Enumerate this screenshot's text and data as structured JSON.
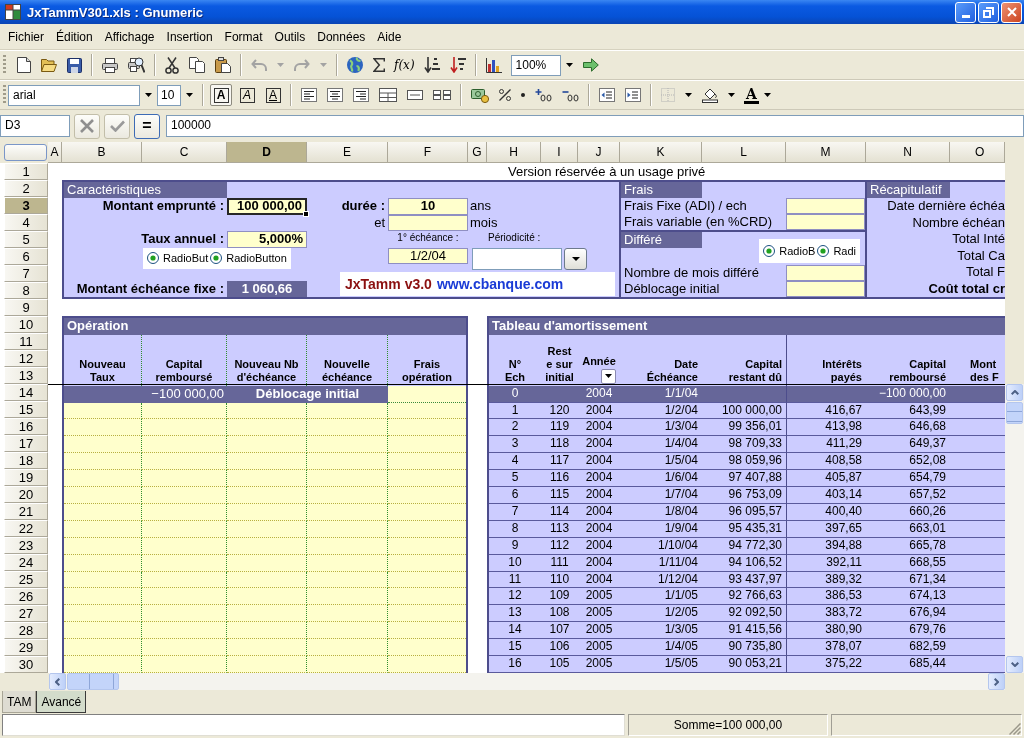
{
  "window": {
    "title": "JxTammV301.xls : Gnumeric"
  },
  "menu": [
    "Fichier",
    "Édition",
    "Affichage",
    "Insertion",
    "Format",
    "Outils",
    "Données",
    "Aide"
  ],
  "toolbar": {
    "undo_disabled": true,
    "redo_disabled": true,
    "function_label": "f(x)",
    "zoom": "100%"
  },
  "format_bar": {
    "font": "arial",
    "size": "10",
    "styles": [
      {
        "kind": "bold",
        "glyph": "A",
        "on": true
      },
      {
        "kind": "italic",
        "glyph": "A",
        "on": false
      },
      {
        "kind": "underline",
        "glyph": "A",
        "on": false
      }
    ],
    "borders_disabled": true,
    "font_color_glyph": "A"
  },
  "formula_bar": {
    "cell": "D3",
    "cancel_disabled": true,
    "accept_disabled": true,
    "equals": "=",
    "value": "100000"
  },
  "columns": [
    {
      "label": "A",
      "selected": false
    },
    {
      "label": "B",
      "selected": false
    },
    {
      "label": "C",
      "selected": false
    },
    {
      "label": "D",
      "selected": true
    },
    {
      "label": "E",
      "selected": false
    },
    {
      "label": "F",
      "selected": false
    },
    {
      "label": "G",
      "selected": false
    },
    {
      "label": "H",
      "selected": false
    },
    {
      "label": "I",
      "selected": false
    },
    {
      "label": "J",
      "selected": false
    },
    {
      "label": "K",
      "selected": false
    },
    {
      "label": "L",
      "selected": false
    },
    {
      "label": "M",
      "selected": false
    },
    {
      "label": "N",
      "selected": false
    },
    {
      "label": "O",
      "selected": false
    }
  ],
  "rows": [
    {
      "label": "1",
      "selected": false
    },
    {
      "label": "2",
      "selected": false
    },
    {
      "label": "3",
      "selected": true
    },
    {
      "label": "4",
      "selected": false
    },
    {
      "label": "5",
      "selected": false
    },
    {
      "label": "6",
      "selected": false
    },
    {
      "label": "7",
      "selected": false
    },
    {
      "label": "8",
      "selected": false
    },
    {
      "label": "9",
      "selected": false
    },
    {
      "label": "10",
      "selected": false
    },
    {
      "label": "11",
      "selected": false
    },
    {
      "label": "12",
      "selected": false
    },
    {
      "label": "13",
      "selected": false
    },
    {
      "label": "14",
      "selected": false
    },
    {
      "label": "15",
      "selected": false
    },
    {
      "label": "16",
      "selected": false
    },
    {
      "label": "17",
      "selected": false
    },
    {
      "label": "18",
      "selected": false
    },
    {
      "label": "19",
      "selected": false
    },
    {
      "label": "20",
      "selected": false
    },
    {
      "label": "21",
      "selected": false
    },
    {
      "label": "22",
      "selected": false
    },
    {
      "label": "23",
      "selected": false
    },
    {
      "label": "24",
      "selected": false
    },
    {
      "label": "25",
      "selected": false
    },
    {
      "label": "26",
      "selected": false
    },
    {
      "label": "27",
      "selected": false
    },
    {
      "label": "28",
      "selected": false
    },
    {
      "label": "29",
      "selected": false
    },
    {
      "label": "30",
      "selected": false
    }
  ],
  "banner": "Version réservée à un usage privé",
  "caracteristiques": {
    "title": "Caractéristiques",
    "montant": {
      "label": "Montant emprunté :",
      "value": "100 000,00",
      "selected": true
    },
    "duree": {
      "label": "durée :",
      "years": "10",
      "years_unit": "ans",
      "and": "et",
      "months_unit": "mois"
    },
    "taux": {
      "label": "Taux annuel :",
      "value": "5,000%"
    },
    "radios": [
      {
        "label": "RadioBut",
        "checked": true
      },
      {
        "label": "RadioButton",
        "checked": true
      }
    ],
    "first_payment": {
      "label": "1° échéance :",
      "value": "1/2/04"
    },
    "periodicity": {
      "label": "Périodicité :"
    },
    "logo": {
      "name": "JxTamm v3.0",
      "site": "www.cbanque.com"
    },
    "fixed_payment": {
      "label": "Montant échéance fixe :",
      "value": "1 060,66"
    }
  },
  "frais": {
    "title": "Frais",
    "fields": [
      {
        "label": "Frais Fixe (ADI) / ech"
      },
      {
        "label": "Frais variable (en %CRD)"
      }
    ]
  },
  "differe": {
    "title": "Différé",
    "radios": [
      {
        "label": "RadioB",
        "checked": true
      },
      {
        "label": "Radi",
        "checked": true
      }
    ],
    "fields": [
      {
        "label": "Nombre de mois différé"
      },
      {
        "label": "Déblocage initial"
      }
    ]
  },
  "recapitulatif": {
    "title": "Récapitulatif",
    "items": [
      {
        "label": "Date dernière échéa",
        "bold": false
      },
      {
        "label": "Nombre échéan",
        "bold": false
      },
      {
        "label": "Total Inté",
        "bold": false
      },
      {
        "label": "Total Ca",
        "bold": false
      },
      {
        "label": "Total F",
        "bold": false
      },
      {
        "label": "Coût total cr",
        "bold": true
      }
    ]
  },
  "operation": {
    "title": "Opération",
    "columns": [
      "Nouveau\nTaux",
      "Capital\nremboursé",
      "Nouveau Nb\nd'échéance",
      "Nouvelle\néchéance",
      "Frais\nopération"
    ],
    "initial": {
      "capital": "−100 000,00",
      "label": "Déblocage initial"
    }
  },
  "amortissement": {
    "title": "Tableau d'amortissement",
    "columns": [
      {
        "label": "N°\nEch",
        "filter": false
      },
      {
        "label": "Rest\ne sur\ninitial",
        "filter": false
      },
      {
        "label": "Année",
        "filter": true
      },
      {
        "label": "Date\nÉchéance",
        "filter": false
      },
      {
        "label": "Capital\nrestant dû",
        "filter": false
      },
      {
        "label": "Intérêts\npayés",
        "filter": false
      },
      {
        "label": "Capital\nremboursé",
        "filter": false
      },
      {
        "label": "Mont\ndes F",
        "filter": false
      }
    ],
    "rows": [
      {
        "kind": "initial",
        "n": "0",
        "year": "2004",
        "date": "1/1/04",
        "repaid": "−100 000,00"
      },
      {
        "kind": "payment",
        "n": "1",
        "remaining": "120",
        "year": "2004",
        "date": "1/2/04",
        "balance": "100 000,00",
        "interest": "416,67",
        "repaid": "643,99"
      },
      {
        "kind": "payment",
        "n": "2",
        "remaining": "119",
        "year": "2004",
        "date": "1/3/04",
        "balance": "99 356,01",
        "interest": "413,98",
        "repaid": "646,68"
      },
      {
        "kind": "payment",
        "n": "3",
        "remaining": "118",
        "year": "2004",
        "date": "1/4/04",
        "balance": "98 709,33",
        "interest": "411,29",
        "repaid": "649,37"
      },
      {
        "kind": "payment",
        "n": "4",
        "remaining": "117",
        "year": "2004",
        "date": "1/5/04",
        "balance": "98 059,96",
        "interest": "408,58",
        "repaid": "652,08"
      },
      {
        "kind": "payment",
        "n": "5",
        "remaining": "116",
        "year": "2004",
        "date": "1/6/04",
        "balance": "97 407,88",
        "interest": "405,87",
        "repaid": "654,79"
      },
      {
        "kind": "payment",
        "n": "6",
        "remaining": "115",
        "year": "2004",
        "date": "1/7/04",
        "balance": "96 753,09",
        "interest": "403,14",
        "repaid": "657,52"
      },
      {
        "kind": "payment",
        "n": "7",
        "remaining": "114",
        "year": "2004",
        "date": "1/8/04",
        "balance": "96 095,57",
        "interest": "400,40",
        "repaid": "660,26"
      },
      {
        "kind": "payment",
        "n": "8",
        "remaining": "113",
        "year": "2004",
        "date": "1/9/04",
        "balance": "95 435,31",
        "interest": "397,65",
        "repaid": "663,01"
      },
      {
        "kind": "payment",
        "n": "9",
        "remaining": "112",
        "year": "2004",
        "date": "1/10/04",
        "balance": "94 772,30",
        "interest": "394,88",
        "repaid": "665,78"
      },
      {
        "kind": "payment",
        "n": "10",
        "remaining": "111",
        "year": "2004",
        "date": "1/11/04",
        "balance": "94 106,52",
        "interest": "392,11",
        "repaid": "668,55"
      },
      {
        "kind": "payment",
        "n": "11",
        "remaining": "110",
        "year": "2004",
        "date": "1/12/04",
        "balance": "93 437,97",
        "interest": "389,32",
        "repaid": "671,34"
      },
      {
        "kind": "payment",
        "n": "12",
        "remaining": "109",
        "year": "2005",
        "date": "1/1/05",
        "balance": "92 766,63",
        "interest": "386,53",
        "repaid": "674,13"
      },
      {
        "kind": "payment",
        "n": "13",
        "remaining": "108",
        "year": "2005",
        "date": "1/2/05",
        "balance": "92 092,50",
        "interest": "383,72",
        "repaid": "676,94"
      },
      {
        "kind": "payment",
        "n": "14",
        "remaining": "107",
        "year": "2005",
        "date": "1/3/05",
        "balance": "91 415,56",
        "interest": "380,90",
        "repaid": "679,76"
      },
      {
        "kind": "payment",
        "n": "15",
        "remaining": "106",
        "year": "2005",
        "date": "1/4/05",
        "balance": "90 735,80",
        "interest": "378,07",
        "repaid": "682,59"
      },
      {
        "kind": "payment",
        "n": "16",
        "remaining": "105",
        "year": "2005",
        "date": "1/5/05",
        "balance": "90 053,21",
        "interest": "375,22",
        "repaid": "685,44"
      }
    ]
  },
  "sheet_tabs": [
    {
      "label": "TAM",
      "selected": true
    },
    {
      "label": "Avancé",
      "selected": false
    }
  ],
  "status_bar": {
    "sum": "Somme=100 000,00"
  }
}
